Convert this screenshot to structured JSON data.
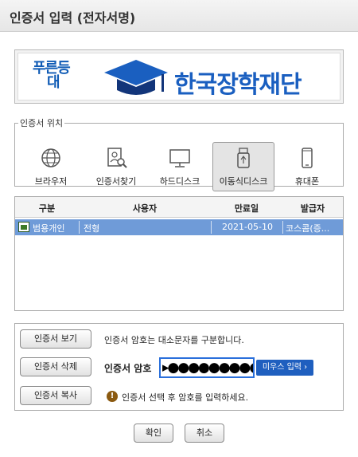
{
  "window": {
    "title": "인증서 입력 (전자서명)"
  },
  "banner": {
    "logo_line1": "푸른등",
    "logo_line2": "대",
    "org_name": "한국장학재단",
    "colors": {
      "brand_blue": "#1a5fc0",
      "navy": "#12357a"
    }
  },
  "location": {
    "legend": "인증서 위치",
    "buttons": [
      {
        "label": "브라우저",
        "icon": "globe-icon"
      },
      {
        "label": "인증서찾기",
        "icon": "find-certificate-icon"
      },
      {
        "label": "하드디스크",
        "icon": "monitor-icon"
      },
      {
        "label": "이동식디스크",
        "icon": "usb-drive-icon",
        "selected": true
      },
      {
        "label": "휴대폰",
        "icon": "mobile-phone-icon"
      }
    ]
  },
  "cert_table": {
    "columns": [
      "구분",
      "사용자",
      "만료일",
      "발급자"
    ],
    "rows": [
      {
        "type": "범용개인",
        "user": "전형",
        "expiry": "2021-05-10",
        "issuer": "코스콤(증..."
      }
    ],
    "selected_row_color": "#6f9bd8"
  },
  "panel": {
    "view_button": "인증서 보기",
    "delete_button": "인증서 삭제",
    "copy_button": "인증서 복사",
    "case_notice": "인증서 암호는 대소문자를 구분합니다.",
    "password_label": "인증서 암호",
    "password_value": "▸●●●●●●●●●",
    "mouse_input_button": "미우스 입력 ›",
    "warning_text": "인증서 선택 후 암호를 입력하세요."
  },
  "footer": {
    "ok_button": "확인",
    "cancel_button": "취소"
  }
}
